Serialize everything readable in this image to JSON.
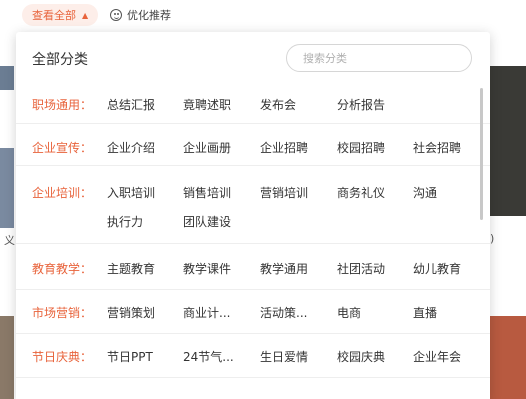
{
  "topbar": {
    "view_all_label": "查看全部",
    "view_all_caret": "▲",
    "optimize_label": "优化推荐"
  },
  "panel": {
    "title": "全部分类",
    "search_placeholder": "搜索分类"
  },
  "categories": [
    {
      "label": "职场通用：",
      "tags": [
        "总结汇报",
        "竟聘述职",
        "发布会",
        "分析报告"
      ]
    },
    {
      "label": "企业宣传：",
      "tags": [
        "企业介绍",
        "企业画册",
        "企业招聘",
        "校园招聘",
        "社会招聘"
      ]
    },
    {
      "label": "企业培训：",
      "tags": [
        "入职培训",
        "销售培训",
        "营销培训",
        "商务礼仪",
        "沟通",
        "执行力",
        "团队建设"
      ]
    },
    {
      "label": "教育教学：",
      "tags": [
        "主题教育",
        "教学课件",
        "教学通用",
        "社团活动",
        "幼儿教育"
      ]
    },
    {
      "label": "市场营销：",
      "tags": [
        "营销策划",
        "商业计...",
        "活动策...",
        "电商",
        "直播"
      ]
    },
    {
      "label": "节日庆典：",
      "tags": [
        "节日PPT",
        "24节气...",
        "生日爱情",
        "校园庆典",
        "企业年会"
      ]
    }
  ],
  "background": {
    "left_char": "义",
    "right_char": ")"
  },
  "colors": {
    "accent": "#e8633b",
    "accent_bg": "#fdeee9",
    "divider": "#eeeeee"
  }
}
